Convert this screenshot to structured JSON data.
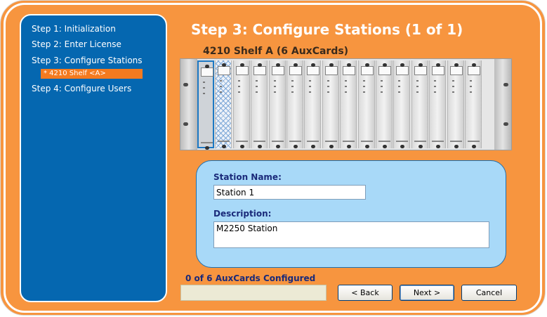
{
  "sidebar": {
    "steps": [
      {
        "label": "Step 1: Initialization"
      },
      {
        "label": "Step 2: Enter License"
      },
      {
        "label": "Step 3: Configure Stations",
        "sub": "* 4210 Shelf <A>"
      },
      {
        "label": "Step 4: Configure Users"
      }
    ]
  },
  "header": {
    "title": "Step 3: Configure Stations (1 of 1)"
  },
  "shelf": {
    "title": "4210 Shelf A (6 AuxCards)",
    "slot_count": 16,
    "selected_slot": 1,
    "highlighted_slot": 2
  },
  "form": {
    "station_name_label": "Station Name:",
    "station_name_value": "Station 1",
    "description_label": "Description:",
    "description_value": "M2250 Station"
  },
  "status": {
    "text": "0 of 6 AuxCards Configured",
    "progress": 0
  },
  "buttons": {
    "back": "< Back",
    "next": "Next >",
    "cancel": "Cancel"
  },
  "colors": {
    "accent": "#f7953f",
    "sidebar": "#0567b0",
    "highlight": "#f47a1f",
    "panel": "#a8d9f8",
    "label_text": "#1a2a7a"
  },
  "icons": {
    "rack": "rack-chassis-icon"
  }
}
